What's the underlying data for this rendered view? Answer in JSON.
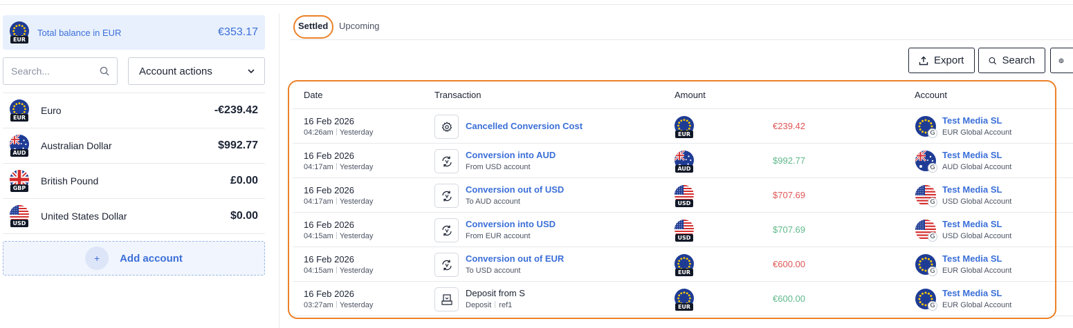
{
  "summary": {
    "total_label": "Total balance in EUR",
    "total_value": "€353.17",
    "currency_code": "EUR"
  },
  "search": {
    "placeholder": "Search..."
  },
  "account_actions": {
    "label": "Account actions"
  },
  "accounts": [
    {
      "name": "Euro",
      "balance": "-€239.42",
      "code": "EUR",
      "flag": "eu"
    },
    {
      "name": "Australian Dollar",
      "balance": "$992.77",
      "code": "AUD",
      "flag": "au"
    },
    {
      "name": "British Pound",
      "balance": "£0.00",
      "code": "GBP",
      "flag": "gb"
    },
    {
      "name": "United States Dollar",
      "balance": "$0.00",
      "code": "USD",
      "flag": "us"
    }
  ],
  "add_account": {
    "plus": "+",
    "label": "Add account"
  },
  "tabs": [
    {
      "label": "Settled",
      "active": true
    },
    {
      "label": "Upcoming",
      "active": false
    }
  ],
  "toolbar": {
    "export_label": "Export",
    "search_label": "Search"
  },
  "table": {
    "headers": {
      "date": "Date",
      "transaction": "Transaction",
      "amount": "Amount",
      "account": "Account"
    },
    "rows": [
      {
        "date": "16 Feb 2026",
        "time": "04:26am",
        "relative": "Yesterday",
        "icon": "gear-icon",
        "title": "Cancelled Conversion Cost",
        "subtitle": "",
        "subtitle_ref": "",
        "title_link": true,
        "amount": "€239.42",
        "direction": "negative",
        "amount_code": "EUR",
        "amount_flag": "eu",
        "account_name": "Test Media SL",
        "account_sub": "EUR Global Account",
        "account_flag": "eu",
        "account_badge": "G"
      },
      {
        "date": "16 Feb 2026",
        "time": "04:17am",
        "relative": "Yesterday",
        "icon": "exchange-icon",
        "title": "Conversion into AUD",
        "subtitle": "From USD account",
        "subtitle_ref": "",
        "title_link": true,
        "amount": "$992.77",
        "direction": "positive",
        "amount_code": "AUD",
        "amount_flag": "au",
        "account_name": "Test Media SL",
        "account_sub": "AUD Global Account",
        "account_flag": "au",
        "account_badge": "G"
      },
      {
        "date": "16 Feb 2026",
        "time": "04:17am",
        "relative": "Yesterday",
        "icon": "exchange-icon",
        "title": "Conversion out of USD",
        "subtitle": "To AUD account",
        "subtitle_ref": "",
        "title_link": true,
        "amount": "$707.69",
        "direction": "negative",
        "amount_code": "USD",
        "amount_flag": "us",
        "account_name": "Test Media SL",
        "account_sub": "USD Global Account",
        "account_flag": "us",
        "account_badge": "G"
      },
      {
        "date": "16 Feb 2026",
        "time": "04:15am",
        "relative": "Yesterday",
        "icon": "exchange-icon",
        "title": "Conversion into USD",
        "subtitle": "From EUR account",
        "subtitle_ref": "",
        "title_link": true,
        "amount": "$707.69",
        "direction": "positive",
        "amount_code": "USD",
        "amount_flag": "us",
        "account_name": "Test Media SL",
        "account_sub": "USD Global Account",
        "account_flag": "us",
        "account_badge": "G"
      },
      {
        "date": "16 Feb 2026",
        "time": "04:15am",
        "relative": "Yesterday",
        "icon": "exchange-icon",
        "title": "Conversion out of EUR",
        "subtitle": "To USD account",
        "subtitle_ref": "",
        "title_link": true,
        "amount": "€600.00",
        "direction": "negative",
        "amount_code": "EUR",
        "amount_flag": "eu",
        "account_name": "Test Media SL",
        "account_sub": "EUR Global Account",
        "account_flag": "eu",
        "account_badge": "G"
      },
      {
        "date": "16 Feb 2026",
        "time": "03:27am",
        "relative": "Yesterday",
        "icon": "deposit-icon",
        "title": "Deposit from S",
        "subtitle": "Deposit",
        "subtitle_ref": "ref1",
        "title_link": false,
        "amount": "€600.00",
        "direction": "positive",
        "amount_code": "EUR",
        "amount_flag": "eu",
        "account_name": "Test Media SL",
        "account_sub": "EUR Global Account",
        "account_flag": "eu",
        "account_badge": "G"
      }
    ]
  },
  "colors": {
    "accent": "#3b6fd8",
    "negative": "#e05656",
    "positive": "#5fb88a",
    "highlight": "#ec8127"
  }
}
